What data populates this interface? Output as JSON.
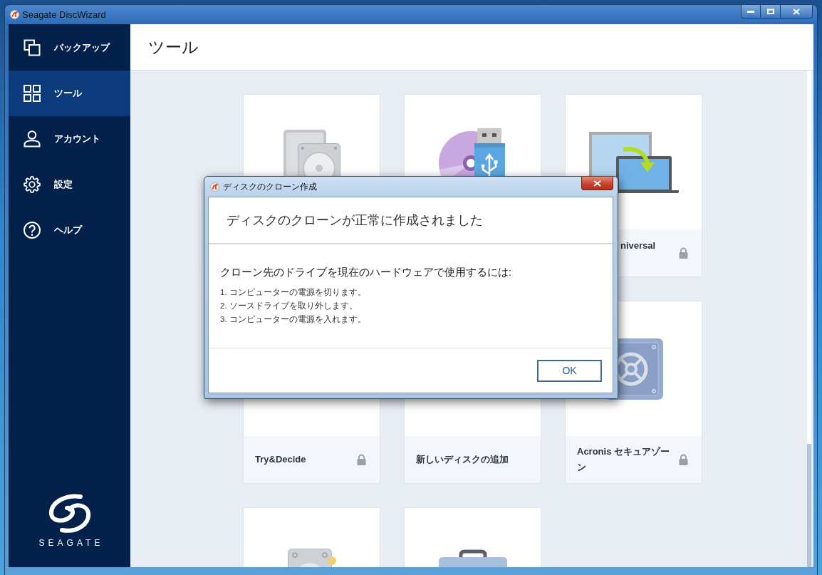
{
  "window": {
    "title": "Seagate DiscWizard"
  },
  "sidebar": {
    "items": [
      {
        "label": "バックアップ",
        "selected": false
      },
      {
        "label": "ツール",
        "selected": true
      },
      {
        "label": "アカウント",
        "selected": false
      },
      {
        "label": "設定",
        "selected": false
      },
      {
        "label": "ヘルプ",
        "selected": false
      }
    ],
    "logo_text": "SEAGATE"
  },
  "page": {
    "title": "ツール"
  },
  "tools": [
    {
      "kind": "disks"
    },
    {
      "kind": "media"
    },
    {
      "kind": "migrate",
      "label": "niversal",
      "locked": true
    },
    {
      "kind": "covered",
      "label": "Try&Decide",
      "locked": true
    },
    {
      "kind": "covered",
      "label": "新しいディスクの追加",
      "locked": false
    },
    {
      "kind": "safe",
      "label": "Acronis セキュアゾーン",
      "locked": true
    },
    {
      "kind": "drive"
    },
    {
      "kind": "case"
    }
  ],
  "dialog": {
    "title": "ディスクのクローン作成",
    "heading": "ディスクのクローンが正常に作成されました",
    "intro": "クローン先のドライブを現在のハードウェアで使用するには:",
    "steps": [
      "1. コンピューターの電源を切ります。",
      "2. ソースドライブを取り外します。",
      "3. コンピューターの電源を入れます。"
    ],
    "buttons": [
      "OK"
    ]
  }
}
